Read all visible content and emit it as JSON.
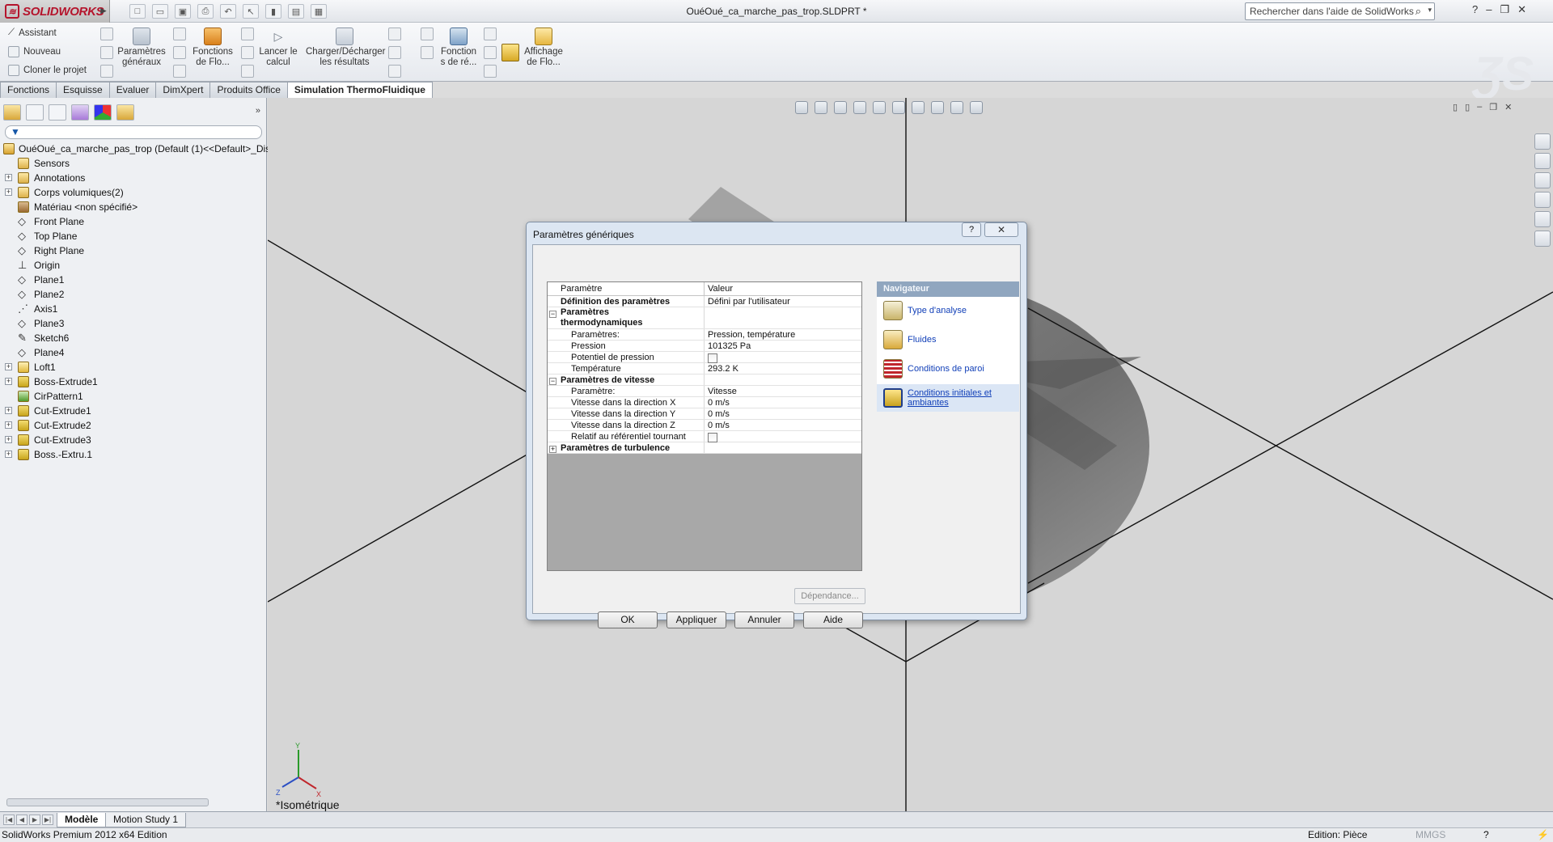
{
  "app": {
    "logo_text": "SOLIDWORKS",
    "document_title": "OuéOué_ca_marche_pas_trop.SLDPRT *",
    "help_search_placeholder": "Rechercher dans l'aide de SolidWorks"
  },
  "command_manager": {
    "assistant": "Assistant",
    "nouveau": "Nouveau",
    "cloner": "Cloner le projet",
    "parametres_generaux": [
      "Paramètres",
      "généraux"
    ],
    "fonctions_flo": [
      "Fonctions",
      "de Flo..."
    ],
    "lancer": [
      "Lancer le",
      "calcul"
    ],
    "charger": [
      "Charger/Décharger",
      "les résultats"
    ],
    "fonctions_ref": [
      "Fonction",
      "s de ré..."
    ],
    "affichage": [
      "Affichage",
      "de Flo..."
    ]
  },
  "tabs": [
    {
      "label": "Fonctions",
      "active": false
    },
    {
      "label": "Esquisse",
      "active": false
    },
    {
      "label": "Evaluer",
      "active": false
    },
    {
      "label": "DimXpert",
      "active": false
    },
    {
      "label": "Produits Office",
      "active": false
    },
    {
      "label": "Simulation ThermoFluidique",
      "active": true
    }
  ],
  "feature_tree": {
    "root": "OuéOué_ca_marche_pas_trop  (Default (1)<<Default>_Dis",
    "items": [
      {
        "label": "Sensors",
        "expandable": false,
        "icon": "folder-icon"
      },
      {
        "label": "Annotations",
        "expandable": true,
        "icon": "annotations-icon"
      },
      {
        "label": "Corps volumiques(2)",
        "expandable": true,
        "icon": "folder-icon"
      },
      {
        "label": "Matériau <non spécifié>",
        "expandable": false,
        "icon": "material-icon"
      },
      {
        "label": "Front Plane",
        "expandable": false,
        "icon": "plane-icon"
      },
      {
        "label": "Top Plane",
        "expandable": false,
        "icon": "plane-icon"
      },
      {
        "label": "Right Plane",
        "expandable": false,
        "icon": "plane-icon"
      },
      {
        "label": "Origin",
        "expandable": false,
        "icon": "origin-icon"
      },
      {
        "label": "Plane1",
        "expandable": false,
        "icon": "plane-icon"
      },
      {
        "label": "Plane2",
        "expandable": false,
        "icon": "plane-icon"
      },
      {
        "label": "Axis1",
        "expandable": false,
        "icon": "axis-icon"
      },
      {
        "label": "Plane3",
        "expandable": false,
        "icon": "plane-icon"
      },
      {
        "label": "Sketch6",
        "expandable": false,
        "icon": "sketch-icon"
      },
      {
        "label": "Plane4",
        "expandable": false,
        "icon": "plane-icon"
      },
      {
        "label": "Loft1",
        "expandable": true,
        "icon": "loft-icon"
      },
      {
        "label": "Boss-Extrude1",
        "expandable": true,
        "icon": "feature-icon"
      },
      {
        "label": "CirPattern1",
        "expandable": false,
        "icon": "pattern-icon"
      },
      {
        "label": "Cut-Extrude1",
        "expandable": true,
        "icon": "feature-icon"
      },
      {
        "label": "Cut-Extrude2",
        "expandable": true,
        "icon": "feature-icon"
      },
      {
        "label": "Cut-Extrude3",
        "expandable": true,
        "icon": "feature-icon"
      },
      {
        "label": "Boss.-Extru.1",
        "expandable": true,
        "icon": "feature-icon"
      }
    ]
  },
  "viewport": {
    "view_name": "*Isométrique"
  },
  "dialog": {
    "title": "Paramètres génériques",
    "help": "?",
    "columns": {
      "param": "Paramètre",
      "value": "Valeur"
    },
    "rows": [
      {
        "param": "Définition des paramètres",
        "value": "Défini par l'utilisateur",
        "bold": true,
        "indent": 0
      },
      {
        "param": "Paramètres thermodynamiques",
        "value": "",
        "bold": true,
        "indent": 0,
        "group": "minus",
        "tall": true
      },
      {
        "param": "Paramètres:",
        "value": "Pression, température",
        "indent": 1
      },
      {
        "param": "Pression",
        "value": "101325 Pa",
        "indent": 1
      },
      {
        "param": "Potentiel de pression",
        "value": "",
        "checkbox": true,
        "indent": 1
      },
      {
        "param": "Température",
        "value": "293.2 K",
        "indent": 1
      },
      {
        "param": "Paramètres de vitesse",
        "value": "",
        "bold": true,
        "indent": 0,
        "group": "minus"
      },
      {
        "param": "Paramètre:",
        "value": "Vitesse",
        "indent": 1
      },
      {
        "param": "Vitesse dans la direction X",
        "value": "0 m/s",
        "indent": 1
      },
      {
        "param": "Vitesse dans la direction Y",
        "value": "0 m/s",
        "indent": 1
      },
      {
        "param": "Vitesse dans la direction Z",
        "value": "0 m/s",
        "indent": 1
      },
      {
        "param": "Relatif au référentiel tournant",
        "value": "",
        "checkbox": true,
        "indent": 1
      },
      {
        "param": "Paramètres de turbulence",
        "value": "",
        "bold": true,
        "indent": 0,
        "group": "plus"
      }
    ],
    "navigator": {
      "header": "Navigateur",
      "items": [
        {
          "label": "Type d'analyse",
          "icon": "analysis-type-icon",
          "selected": false
        },
        {
          "label": "Fluides",
          "icon": "fluids-icon",
          "selected": false
        },
        {
          "label": "Conditions de paroi",
          "icon": "wall-conditions-icon",
          "selected": false
        },
        {
          "label": "Conditions initiales et ambiantes",
          "icon": "initial-conditions-icon",
          "selected": true
        }
      ]
    },
    "dependance_button": "Dépendance...",
    "buttons": {
      "ok": "OK",
      "apply": "Appliquer",
      "cancel": "Annuler",
      "help": "Aide"
    }
  },
  "bottom_tabs": [
    {
      "label": "Modèle",
      "active": true
    },
    {
      "label": "Motion Study 1",
      "active": false
    }
  ],
  "status": {
    "left": "SolidWorks Premium 2012 x64 Edition",
    "edition": "Edition: Pièce",
    "units": "MMGS"
  },
  "colors": {
    "accent": "#b5142c",
    "navigator_header": "#90a6bf",
    "link": "#1240b8"
  }
}
